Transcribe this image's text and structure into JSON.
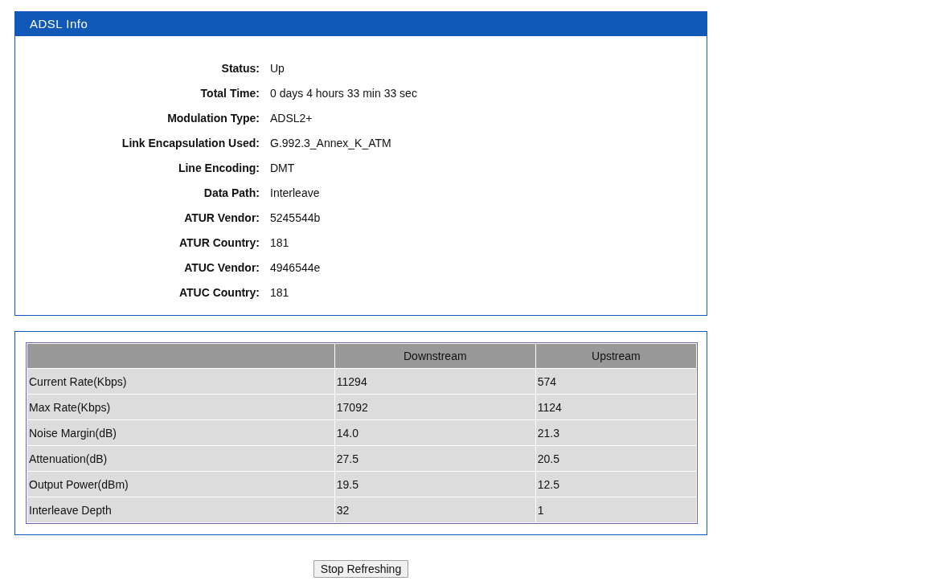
{
  "info_panel": {
    "title": "ADSL Info",
    "fields": [
      {
        "label": "Status:",
        "value": "Up"
      },
      {
        "label": "Total Time:",
        "value": "0 days 4 hours 33 min 33 sec"
      },
      {
        "label": "Modulation Type:",
        "value": "ADSL2+"
      },
      {
        "label": "Link Encapsulation Used:",
        "value": "G.992.3_Annex_K_ATM"
      },
      {
        "label": "Line Encoding:",
        "value": "DMT"
      },
      {
        "label": "Data Path:",
        "value": "Interleave"
      },
      {
        "label": "ATUR Vendor:",
        "value": "5245544b"
      },
      {
        "label": "ATUR Country:",
        "value": "181"
      },
      {
        "label": "ATUC Vendor:",
        "value": "4946544e"
      },
      {
        "label": "ATUC Country:",
        "value": "181"
      }
    ]
  },
  "stats_table": {
    "columns": [
      "",
      "Downstream",
      "Upstream"
    ],
    "rows": [
      [
        "Current Rate(Kbps)",
        "11294",
        "574"
      ],
      [
        "Max Rate(Kbps)",
        "17092",
        "1124"
      ],
      [
        "Noise Margin(dB)",
        "14.0",
        "21.3"
      ],
      [
        "Attenuation(dB)",
        "27.5",
        "20.5"
      ],
      [
        "Output Power(dBm)",
        "19.5",
        "12.5"
      ],
      [
        "Interleave Depth",
        "32",
        "1"
      ]
    ]
  },
  "buttons": [
    "Stop Refreshing"
  ]
}
